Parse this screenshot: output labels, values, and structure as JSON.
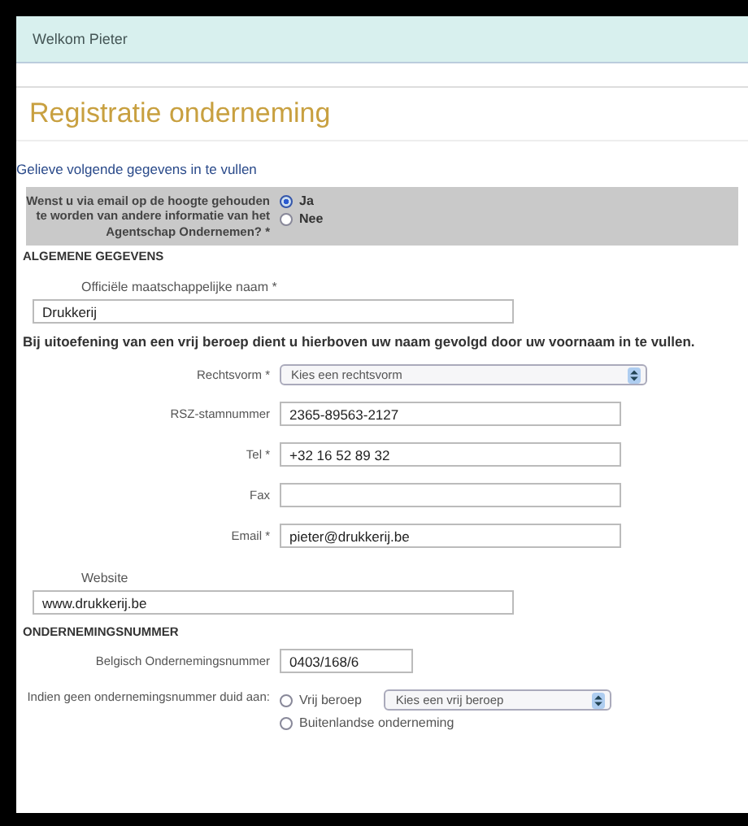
{
  "header": {
    "welcome": "Welkom Pieter"
  },
  "title": "Registratie onderneming",
  "intro": "Gelieve volgende gegevens in te vullen",
  "newsletter": {
    "question": "Wenst u via email op de hoogte gehouden te worden van andere informatie van het Agentschap Ondernemen? *",
    "options": [
      {
        "label": "Ja",
        "selected": true
      },
      {
        "label": "Nee",
        "selected": false
      }
    ]
  },
  "sections": [
    {
      "heading": "ALGEMENE GEGEVENS",
      "fields": [
        {
          "kind": "wide",
          "label": "Officiële maatschappelijke naam *",
          "value": "Drukkerij"
        },
        {
          "kind": "note",
          "text": "Bij uitoefening van een vrij beroep dient u hierboven uw naam gevolgd door uw voornaam in te vullen."
        },
        {
          "kind": "select",
          "label": "Rechtsvorm *",
          "value": "Kies een rechtsvorm"
        },
        {
          "kind": "input",
          "label": "RSZ-stamnummer",
          "value": "2365-89563-2127"
        },
        {
          "kind": "input",
          "label": "Tel *",
          "value": "+32 16 52 89 32"
        },
        {
          "kind": "input",
          "label": "Fax"
        },
        {
          "kind": "input",
          "label": "Email *",
          "value": "pieter@drukkerij.be"
        },
        {
          "kind": "wide",
          "label": "Website",
          "value": "www.drukkerij.be"
        }
      ]
    },
    {
      "heading": "ONDERNEMINGSNUMMER",
      "fields": [
        {
          "kind": "short",
          "label": "Belgisch Ondernemingsnummer",
          "value": "0403/168/6"
        },
        {
          "kind": "choice",
          "label": "Indien geen ondernemingsnummer duid aan:",
          "options": [
            {
              "label": "Vrij beroep",
              "selected": false,
              "select": "Kies een vrij beroep"
            },
            {
              "label": "Buitenlandse onderneming",
              "selected": false
            }
          ]
        }
      ]
    }
  ]
}
